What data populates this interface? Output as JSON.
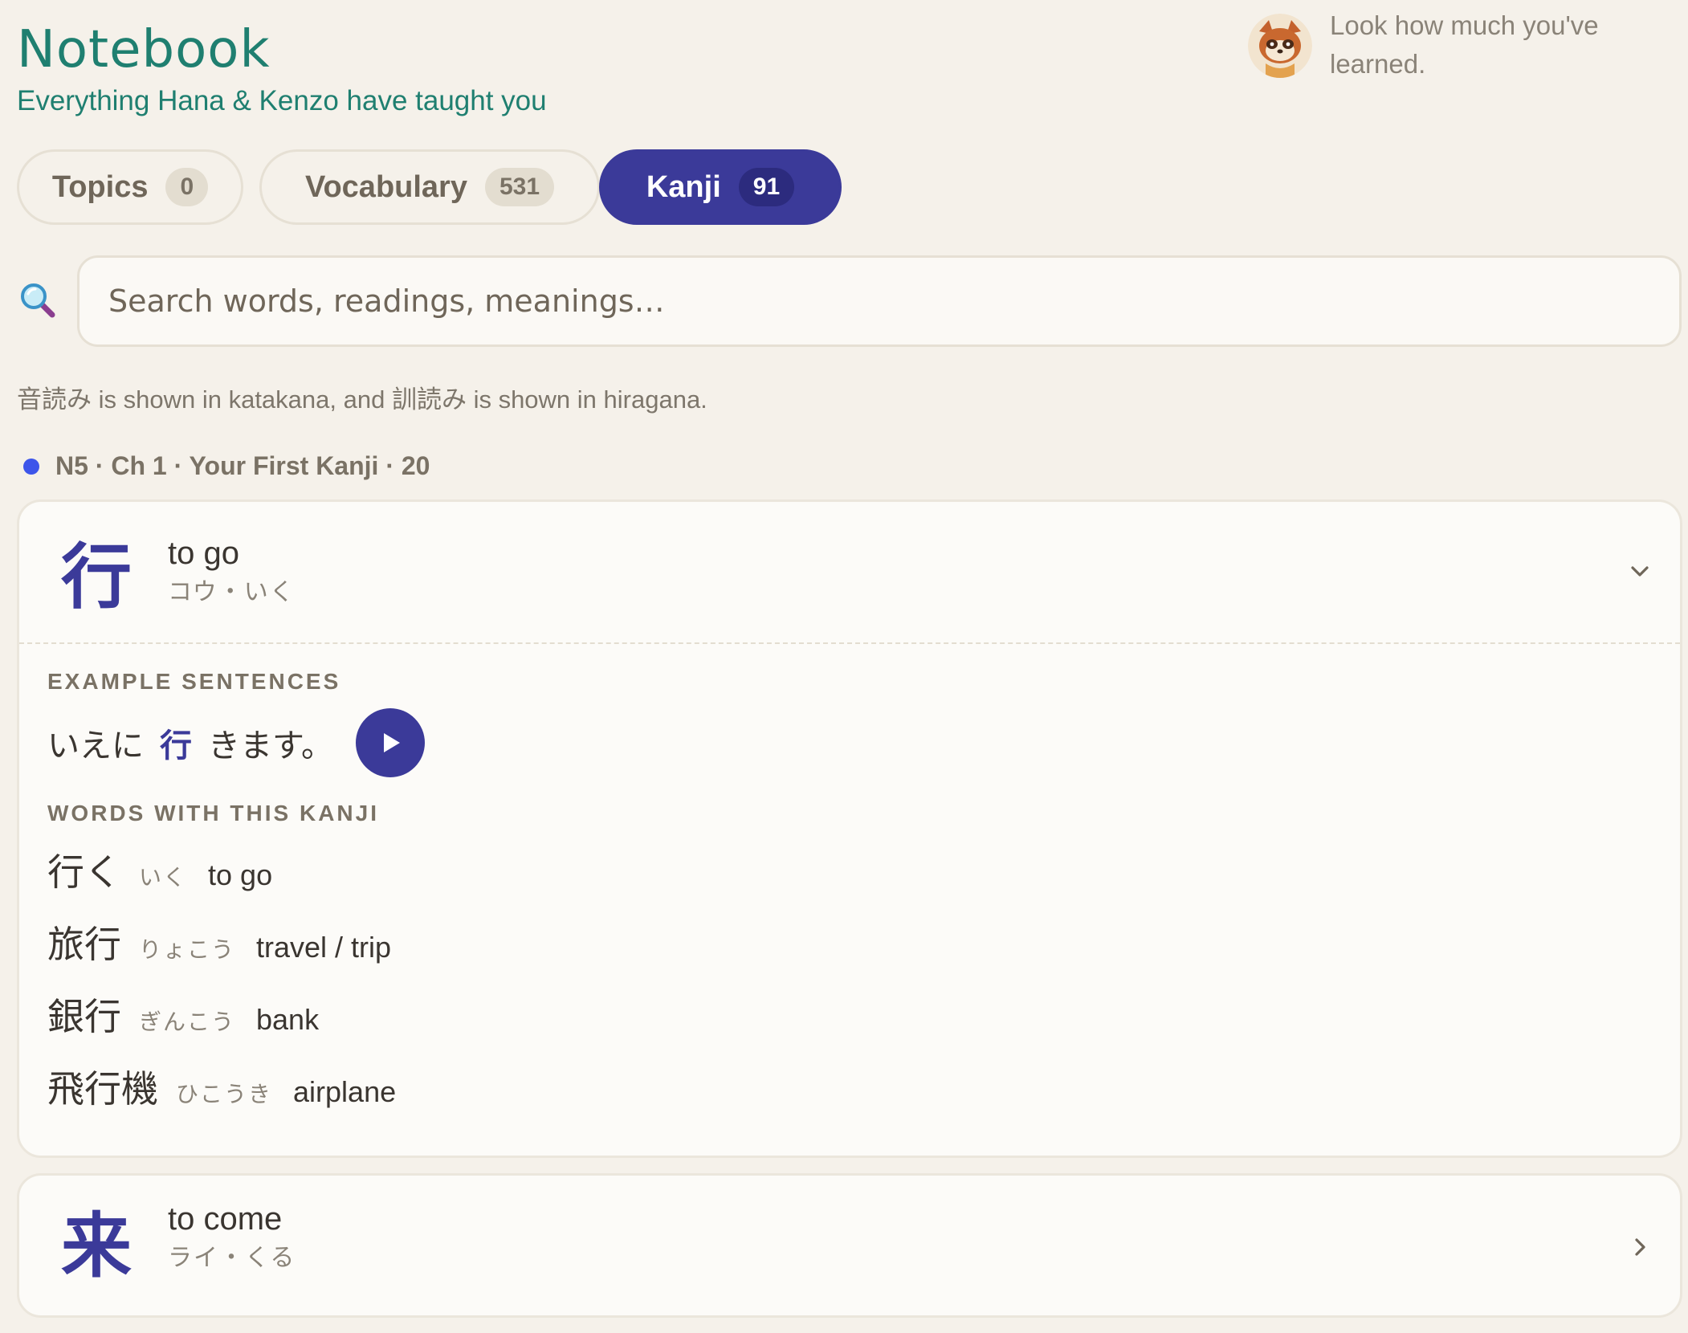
{
  "header": {
    "title": "Notebook",
    "subtitle": "Everything Hana & Kenzo have taught you",
    "mascot_message": "Look how much you've learned."
  },
  "tabs": [
    {
      "label": "Topics",
      "count": "0",
      "active": false
    },
    {
      "label": "Vocabulary",
      "count": "531",
      "active": false
    },
    {
      "label": "Kanji",
      "count": "91",
      "active": true
    }
  ],
  "search": {
    "placeholder": "Search words, readings, meanings…",
    "value": ""
  },
  "note": "音読み is shown in katakana, and 訓読み is shown in hiragana.",
  "section": {
    "title": "N5 · Ch 1 · Your First Kanji · 20",
    "dot_color": "#3d55ea"
  },
  "colors": {
    "accent": "#3b3a99",
    "title": "#1f7f70",
    "background": "#f5f1ea"
  },
  "cards": [
    {
      "kanji": "行",
      "meaning": "to go",
      "readings": "コウ・いく",
      "expanded": true,
      "example_label": "EXAMPLE SENTENCES",
      "example": {
        "before": "いえに",
        "highlight": "行",
        "after": "きます。"
      },
      "words_label": "WORDS WITH THIS KANJI",
      "words": [
        {
          "word": "行く",
          "reading": "いく",
          "meaning": "to go"
        },
        {
          "word": "旅行",
          "reading": "りょこう",
          "meaning": "travel / trip"
        },
        {
          "word": "銀行",
          "reading": "ぎんこう",
          "meaning": "bank"
        },
        {
          "word": "飛行機",
          "reading": "ひこうき",
          "meaning": "airplane"
        }
      ]
    },
    {
      "kanji": "来",
      "meaning": "to come",
      "readings": "ライ・くる",
      "expanded": false
    }
  ]
}
